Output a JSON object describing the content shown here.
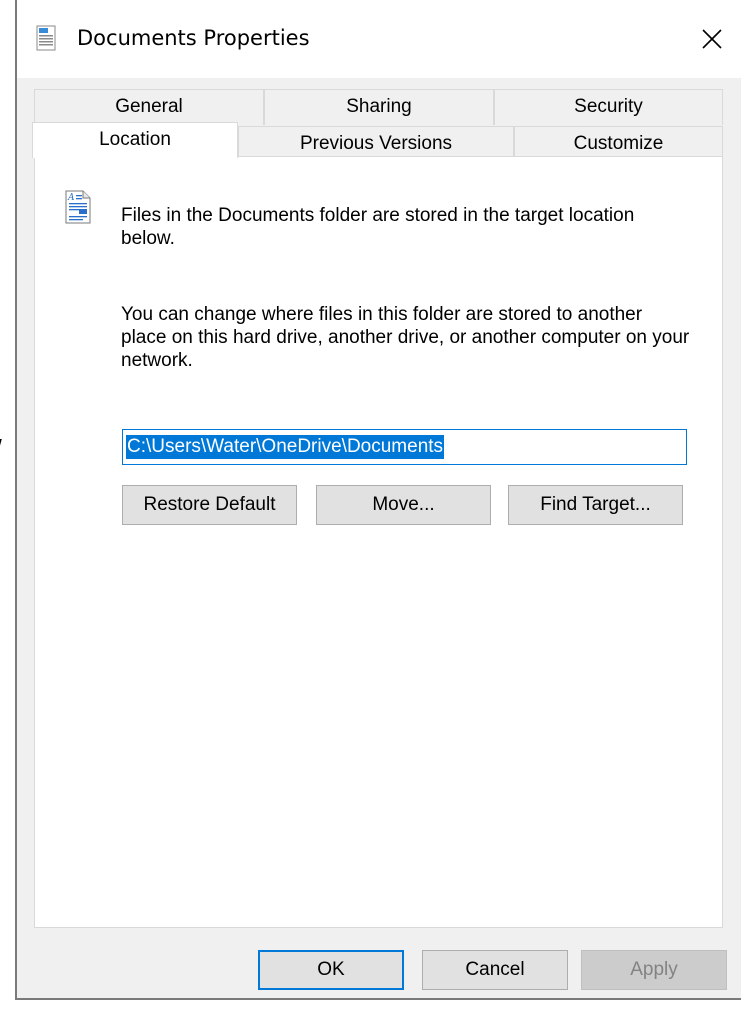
{
  "window": {
    "title": "Documents Properties"
  },
  "edge_text": "/",
  "tabs_row1": [
    {
      "label": "General"
    },
    {
      "label": "Sharing"
    },
    {
      "label": "Security"
    }
  ],
  "tabs_row2": [
    {
      "label": "Location",
      "active": true
    },
    {
      "label": "Previous Versions"
    },
    {
      "label": "Customize"
    }
  ],
  "location": {
    "intro": "Files in the Documents folder are stored in the target location below.",
    "description": "You can change where files in this folder are stored to another place on this hard drive, another drive, or another computer on your network.",
    "path_value": "C:\\Users\\Water\\OneDrive\\Documents",
    "buttons": {
      "restore_default": "Restore Default",
      "move": "Move...",
      "find_target": "Find Target..."
    }
  },
  "footer": {
    "ok": "OK",
    "cancel": "Cancel",
    "apply": "Apply"
  },
  "colors": {
    "accent": "#0078d7",
    "dialog_bg": "#f0f0f0",
    "button_bg": "#e1e1e1"
  }
}
